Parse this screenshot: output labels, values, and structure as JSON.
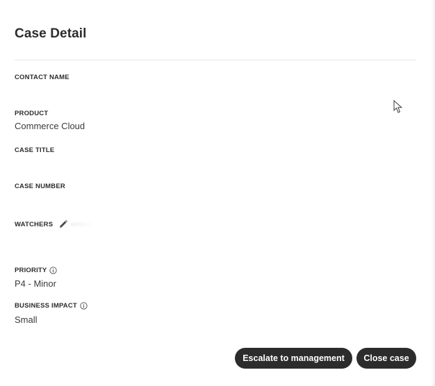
{
  "header": {
    "title": "Case Detail"
  },
  "fields": {
    "contact_name": {
      "label": "CONTACT NAME",
      "value": ""
    },
    "product": {
      "label": "PRODUCT",
      "value": "Commerce Cloud"
    },
    "case_title": {
      "label": "CASE TITLE",
      "value": ""
    },
    "case_number": {
      "label": "CASE NUMBER",
      "value": ""
    },
    "watchers": {
      "label": "WATCHERS",
      "icon": "pencil-icon"
    },
    "priority": {
      "label": "PRIORITY",
      "value": "P4 - Minor",
      "icon": "info-icon"
    },
    "business_impact": {
      "label": "BUSINESS IMPACT",
      "value": "Small",
      "icon": "info-icon"
    }
  },
  "actions": {
    "escalate_label": "Escalate to management",
    "close_label": "Close case"
  },
  "colors": {
    "button_bg": "#2c2c2c",
    "button_text": "#ffffff",
    "text": "#2c2c2c",
    "divider": "#e6e6e6"
  }
}
